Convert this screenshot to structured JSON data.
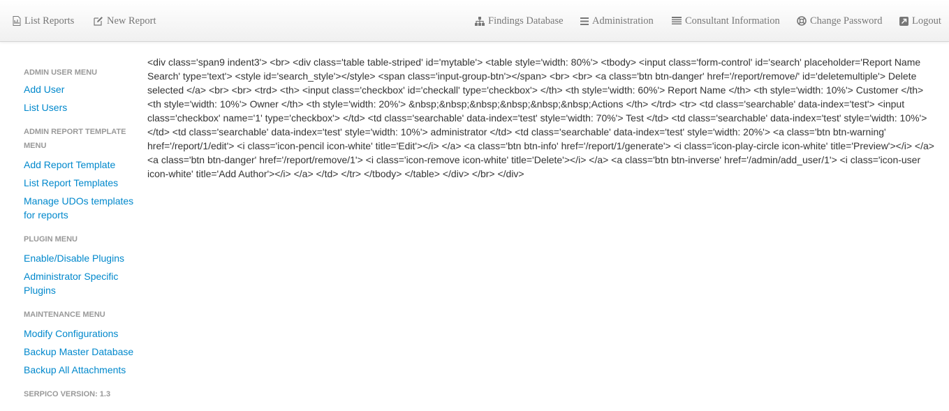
{
  "nav": {
    "list_reports": "List Reports",
    "new_report": "New Report",
    "findings_database": "Findings Database",
    "administration": "Administration",
    "consultant_information": "Consultant Information",
    "change_password": "Change Password",
    "logout": "Logout"
  },
  "sidebar": {
    "admin_user_menu": "ADMIN USER MENU",
    "add_user": "Add User",
    "list_users": "List Users",
    "admin_report_template_menu": "ADMIN REPORT TEMPLATE MENU",
    "add_report_template": "Add Report Template",
    "list_report_templates": "List Report Templates",
    "manage_udos": "Manage UDOs templates for reports",
    "plugin_menu": "PLUGIN MENU",
    "enable_disable_plugins": "Enable/Disable Plugins",
    "administrator_specific_plugins": "Administrator Specific Plugins",
    "maintenance_menu": "MAINTENANCE MENU",
    "modify_configurations": "Modify Configurations",
    "backup_master_database": "Backup Master Database",
    "backup_all_attachments": "Backup All Attachments",
    "version": "SERPICO VERSION: 1.3"
  },
  "main": {
    "raw_html": "<div class='span9 indent3'> <br> <div class='table table-striped' id='mytable'> <table style='width: 80%'> <tbody> <input class='form-control' id='search' placeholder='Report Name Search' type='text'> <style id='search_style'></style> <span class='input-group-btn'></span> <br> <br> <a class='btn btn-danger' href='/report/remove/' id='deletemultiple'> Delete selected </a> <br> <br> <trd> <th> <input class='checkbox' id='checkall' type='checkbox'> </th> <th style='width: 60%'> Report Name </th> <th style='width: 10%'> Customer </th> <th style='width: 10%'> Owner </th> <th style='width: 20%'> &nbsp;&nbsp;&nbsp;&nbsp;&nbsp;&nbsp;Actions </th> </trd> <tr> <td class='searchable' data-index='test'> <input class='checkbox' name='1' type='checkbox'> </td> <td class='searchable' data-index='test' style='width: 70%'> Test </td> <td class='searchable' data-index='test' style='width: 10%'> </td> <td class='searchable' data-index='test' style='width: 10%'> administrator </td> <td class='searchable' data-index='test' style='width: 20%'> <a class='btn btn-warning' href='/report/1/edit'> <i class='icon-pencil icon-white' title='Edit'></i> </a> <a class='btn btn-info' href='/report/1/generate'> <i class='icon-play-circle icon-white' title='Preview'></i> </a> <a class='btn btn-danger' href='/report/remove/1'> <i class='icon-remove icon-white' title='Delete'></i> </a> <a class='btn btn-inverse' href='/admin/add_user/1'> <i class='icon-user icon-white' title='Add Author'></i> </a> </td> </tr> </tbody> </table> </div> </br> </div>"
  }
}
